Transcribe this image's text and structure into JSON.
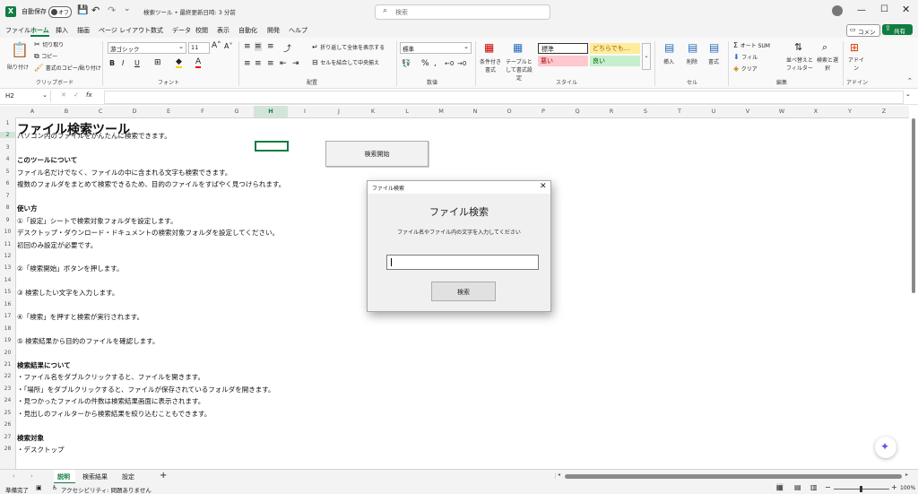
{
  "titlebar": {
    "autosave_label": "自動保存",
    "autosave_state": "オフ",
    "doc_title": "検索ツール • 最終更新日時: 3 分前",
    "search_placeholder": "検索"
  },
  "menu": [
    "ファイル",
    "ホーム",
    "挿入",
    "描画",
    "ページ レイアウト",
    "数式",
    "データ",
    "校閲",
    "表示",
    "自動化",
    "開発",
    "ヘルプ"
  ],
  "comment_label": "コメント",
  "share_label": "共有",
  "ribbon": {
    "paste": "貼り付け",
    "cut": "切り取り",
    "copy": "コピー",
    "format_painter": "書式のコピー/貼り付け",
    "clipboard_group": "クリップボード",
    "font_name": "游ゴシック",
    "font_size": "11",
    "font_group": "フォント",
    "wrap_text": "折り返して全体を表示する",
    "merge_center": "セルを結合して中央揃え",
    "alignment_group": "配置",
    "number_format": "標準",
    "number_group": "数値",
    "conditional_format": "条件付き書式",
    "format_as_table": "テーブルとして書式設定",
    "styles_group": "スタイル",
    "style_normal": "標準",
    "style_neutral": "どちらでも...",
    "style_bad": "悪い",
    "style_good": "良い",
    "insert": "挿入",
    "delete": "削除",
    "format": "書式",
    "cells_group": "セル",
    "autosum": "オート SUM",
    "fill": "フィル",
    "clear": "クリア",
    "sort_filter": "並べ替えとフィルター",
    "find_select": "検索と選択",
    "editing_group": "編集",
    "addins": "アドイン",
    "addins_group": "アドイン"
  },
  "formula_bar": {
    "name_box": "H2",
    "fx": "fx",
    "content": ""
  },
  "columns": [
    "A",
    "B",
    "C",
    "D",
    "E",
    "F",
    "G",
    "H",
    "I",
    "J",
    "K",
    "L",
    "M",
    "N",
    "O",
    "P",
    "Q",
    "R",
    "S",
    "T",
    "U",
    "V",
    "W",
    "X",
    "Y",
    "Z"
  ],
  "rows": [
    "1",
    "2",
    "3",
    "4",
    "5",
    "6",
    "7",
    "8",
    "9",
    "10",
    "11",
    "12",
    "13",
    "14",
    "15",
    "16",
    "17",
    "18",
    "19",
    "20",
    "21",
    "22",
    "23",
    "24",
    "25",
    "26",
    "27",
    "28"
  ],
  "sheet": {
    "r1": "ファイル検索ツール",
    "r2": "パソコン内のファイルをかんたんに検索できます。",
    "r4": "このツールについて",
    "r5": "ファイル名だけでなく、ファイルの中に含まれる文字も検索できます。",
    "r6": "複数のフォルダをまとめて検索できるため、目的のファイルをすばやく見つけられます。",
    "r8": "使い方",
    "r9": "①「設定」シートで検索対象フォルダを設定します。",
    "r10": "  デスクトップ・ダウンロード・ドキュメントの検索対象フォルダを設定してください。",
    "r11": "  初回のみ設定が必要です。",
    "r13": "②「検索開始」ボタンを押します。",
    "r15": "③ 検索したい文字を入力します。",
    "r17": "④「検索」を押すと検索が実行されます。",
    "r19": "⑤ 検索結果から目的のファイルを確認します。",
    "r21": "検索結果について",
    "r22": "・ファイル名をダブルクリックすると、ファイルを開きます。",
    "r23": "・「場所」をダブルクリックすると、ファイルが保存されているフォルダを開きます。",
    "r24": "・見つかったファイルの件数は検索結果画面に表示されます。",
    "r25": "・見出しのフィルターから検索結果を絞り込むこともできます。",
    "r27": "検索対象",
    "r28": "・デスクトップ",
    "search_start_button": "検索開始"
  },
  "dialog": {
    "title": "ファイル検索",
    "heading": "ファイル検索",
    "prompt": "ファイル名やファイル内の文字を入力してください",
    "input_value": "",
    "search_button": "検索"
  },
  "tabs": [
    "説明",
    "検索結果",
    "設定"
  ],
  "add_sheet": "+",
  "status": {
    "ready": "準備完了",
    "accessibility": "アクセシビリティ: 問題ありません",
    "zoom": "100%"
  },
  "colors": {
    "excel_green": "#107c41",
    "style_bad_bg": "#ffc7ce",
    "style_good_bg": "#c6efce",
    "style_neutral_bg": "#ffeb9c"
  }
}
